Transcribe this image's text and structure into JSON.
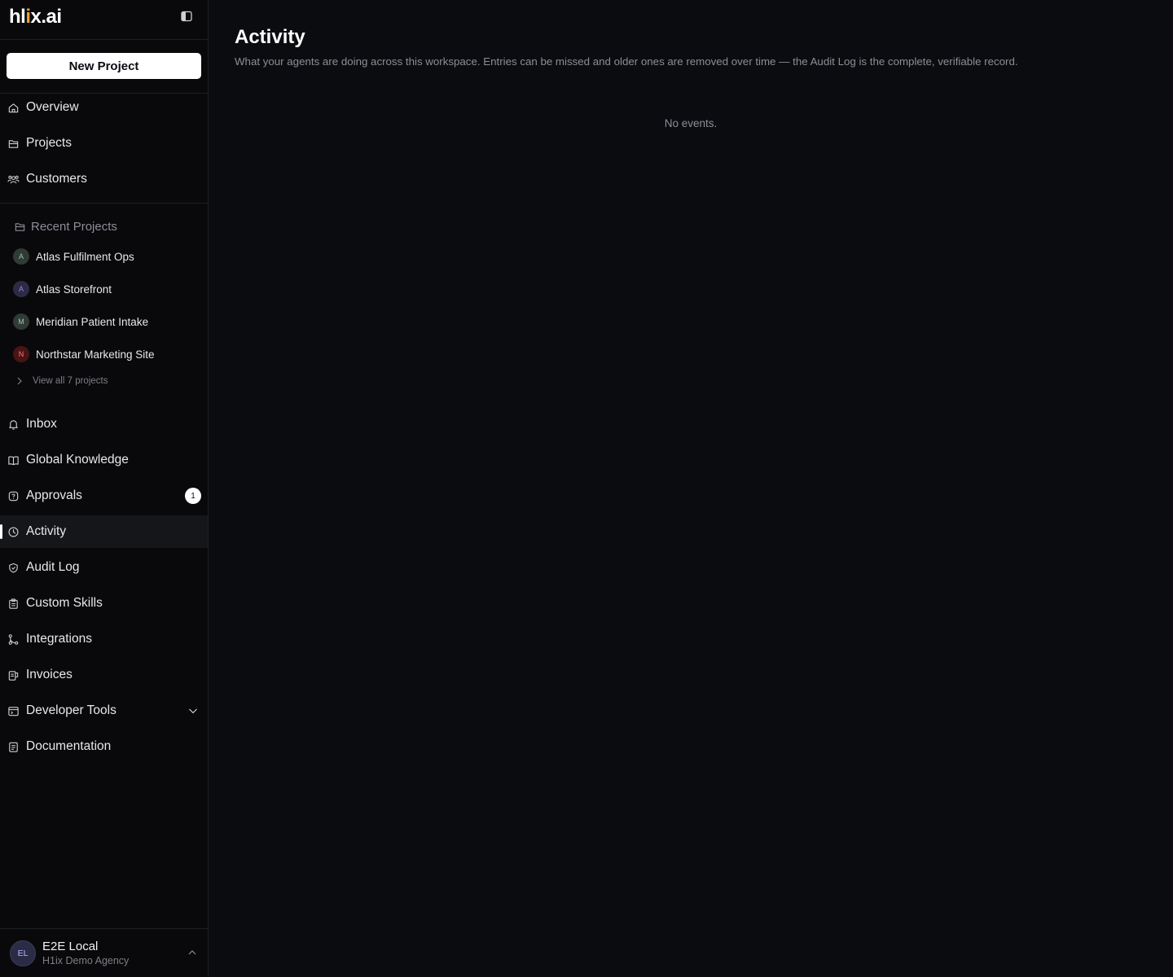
{
  "app": {
    "logo_prefix": "hl",
    "logo_accent": "i",
    "logo_suffix": "x.ai"
  },
  "sidebar": {
    "new_project_label": "New Project",
    "primary_items": [
      {
        "label": "Overview",
        "icon": "home-icon"
      },
      {
        "label": "Projects",
        "icon": "folder-icon"
      },
      {
        "label": "Customers",
        "icon": "users-icon"
      }
    ],
    "recent_projects": {
      "header": "Recent Projects",
      "items": [
        {
          "label": "Atlas Fulfilment Ops",
          "initial": "A",
          "color": "#2f3b34"
        },
        {
          "label": "Atlas Storefront",
          "initial": "A",
          "color": "#2d2a46"
        },
        {
          "label": "Meridian Patient Intake",
          "initial": "M",
          "color": "#2f3b34"
        },
        {
          "label": "Northstar Marketing Site",
          "initial": "N",
          "color": "#4a1414"
        }
      ],
      "view_all_label": "View all 7 projects"
    },
    "secondary_items": [
      {
        "label": "Inbox",
        "icon": "bell-icon"
      },
      {
        "label": "Global Knowledge",
        "icon": "book-icon"
      },
      {
        "label": "Approvals",
        "icon": "question-icon",
        "badge": "1"
      },
      {
        "label": "Activity",
        "icon": "clock-icon",
        "active": true
      },
      {
        "label": "Audit Log",
        "icon": "shield-check-icon"
      },
      {
        "label": "Custom Skills",
        "icon": "clipboard-icon"
      },
      {
        "label": "Integrations",
        "icon": "git-branch-icon"
      },
      {
        "label": "Invoices",
        "icon": "invoice-icon"
      },
      {
        "label": "Developer Tools",
        "icon": "terminal-icon",
        "expandable": true
      },
      {
        "label": "Documentation",
        "icon": "document-icon"
      }
    ],
    "user": {
      "initials": "EL",
      "name": "E2E Local",
      "org": "H1ix Demo Agency"
    }
  },
  "main": {
    "title": "Activity",
    "subtitle": "What your agents are doing across this workspace. Entries can be missed and older ones are removed over time — the Audit Log is the complete, verifiable record.",
    "empty_state": "No events."
  },
  "colors": {
    "background": "#0b0c10",
    "sidebar_bg": "#09090b",
    "accent": "#ffffff",
    "logo_accent": "#e9a13b",
    "muted_text": "#8c8e96"
  }
}
